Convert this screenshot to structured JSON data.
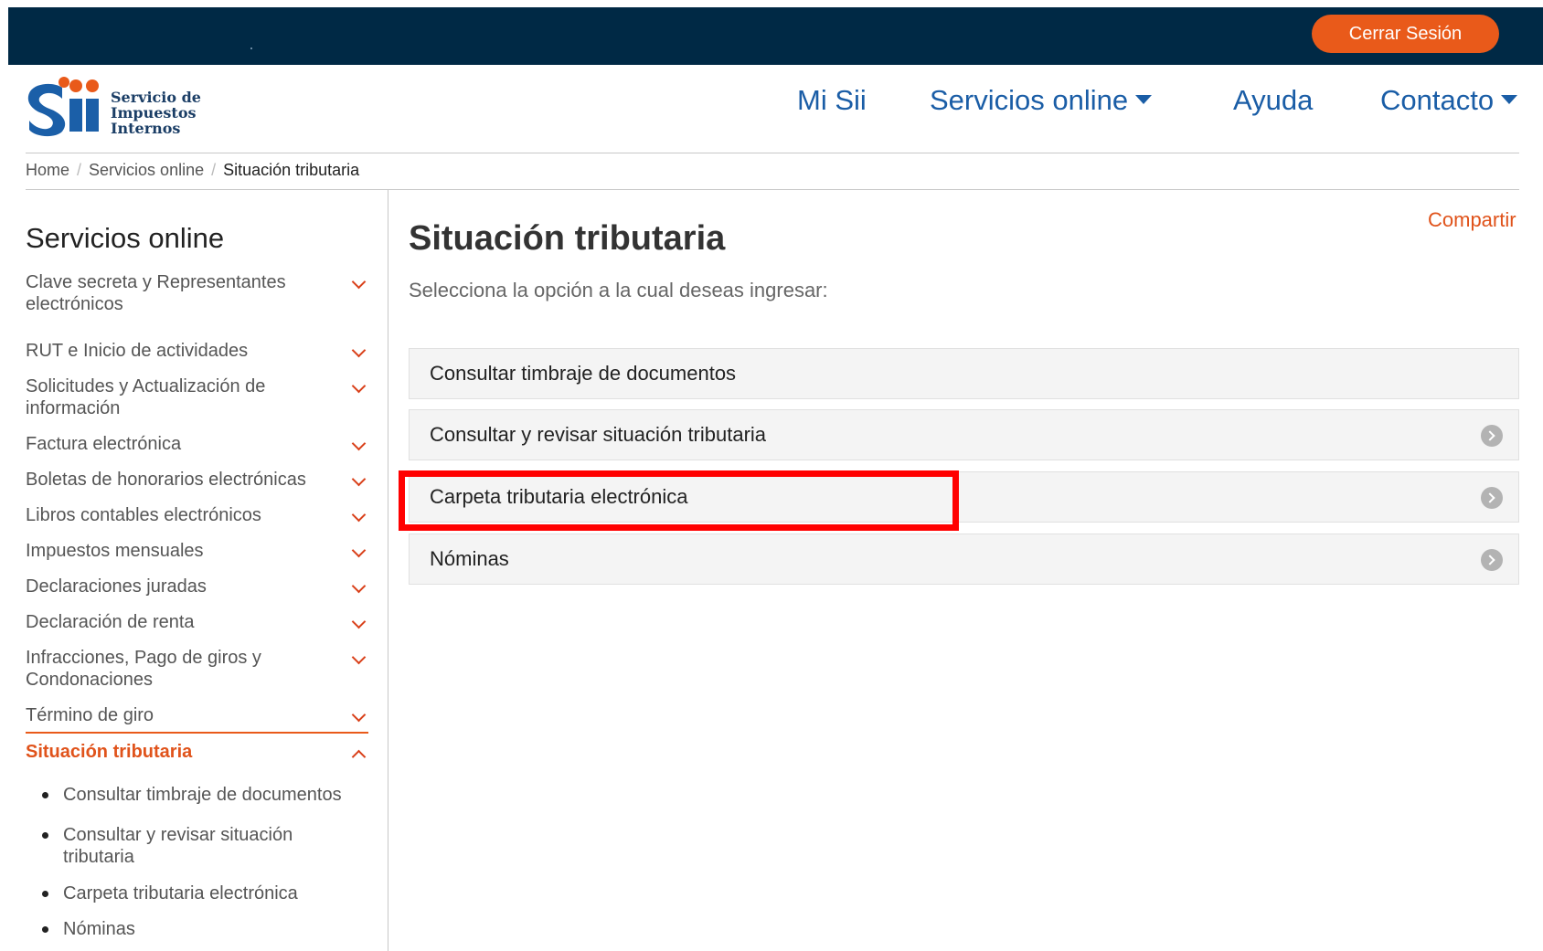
{
  "header": {
    "logout_label": "Cerrar Sesión",
    "logo": {
      "line1": "Servicio de",
      "line2": "Impuestos",
      "line3": "Internos"
    },
    "nav": [
      {
        "label": "Mi Sii",
        "has_dropdown": false
      },
      {
        "label": "Servicios online",
        "has_dropdown": true
      },
      {
        "label": "Ayuda",
        "has_dropdown": false
      },
      {
        "label": "Contacto",
        "has_dropdown": true
      }
    ]
  },
  "breadcrumb": {
    "items": [
      "Home",
      "Servicios online"
    ],
    "current": "Situación tributaria",
    "separator": "/"
  },
  "sidebar": {
    "title": "Servicios online",
    "items": [
      {
        "label": "Clave secreta y Representantes electrónicos",
        "expanded": false
      },
      {
        "label": "RUT e Inicio de actividades",
        "expanded": false
      },
      {
        "label": "Solicitudes y Actualización de información",
        "expanded": false
      },
      {
        "label": "Factura electrónica",
        "expanded": false
      },
      {
        "label": "Boletas de honorarios electrónicas",
        "expanded": false
      },
      {
        "label": "Libros contables electrónicos",
        "expanded": false
      },
      {
        "label": "Impuestos mensuales",
        "expanded": false
      },
      {
        "label": "Declaraciones juradas",
        "expanded": false
      },
      {
        "label": "Declaración de renta",
        "expanded": false
      },
      {
        "label": "Infracciones, Pago de giros y Condonaciones",
        "expanded": false
      },
      {
        "label": "Término de giro",
        "expanded": false
      }
    ],
    "active_section": {
      "label": "Situación tributaria",
      "expanded": true,
      "subitems": [
        "Consultar timbraje de documentos",
        "Consultar y revisar situación tributaria",
        "Carpeta tributaria electrónica",
        "Nóminas"
      ]
    }
  },
  "content": {
    "title": "Situación tributaria",
    "share_label": "Compartir",
    "subtitle": "Selecciona la opción a la cual deseas ingresar:",
    "options": [
      {
        "label": "Consultar timbraje de documentos",
        "has_arrow": false
      },
      {
        "label": "Consultar y revisar situación tributaria",
        "has_arrow": true
      },
      {
        "label": "Carpeta tributaria electrónica",
        "has_arrow": true,
        "highlighted": true
      },
      {
        "label": "Nóminas",
        "has_arrow": true
      }
    ]
  },
  "colors": {
    "topbar": "#002945",
    "accent_orange": "#e95a1a",
    "nav_blue": "#1a5da6",
    "highlight_red": "#ff0000"
  }
}
